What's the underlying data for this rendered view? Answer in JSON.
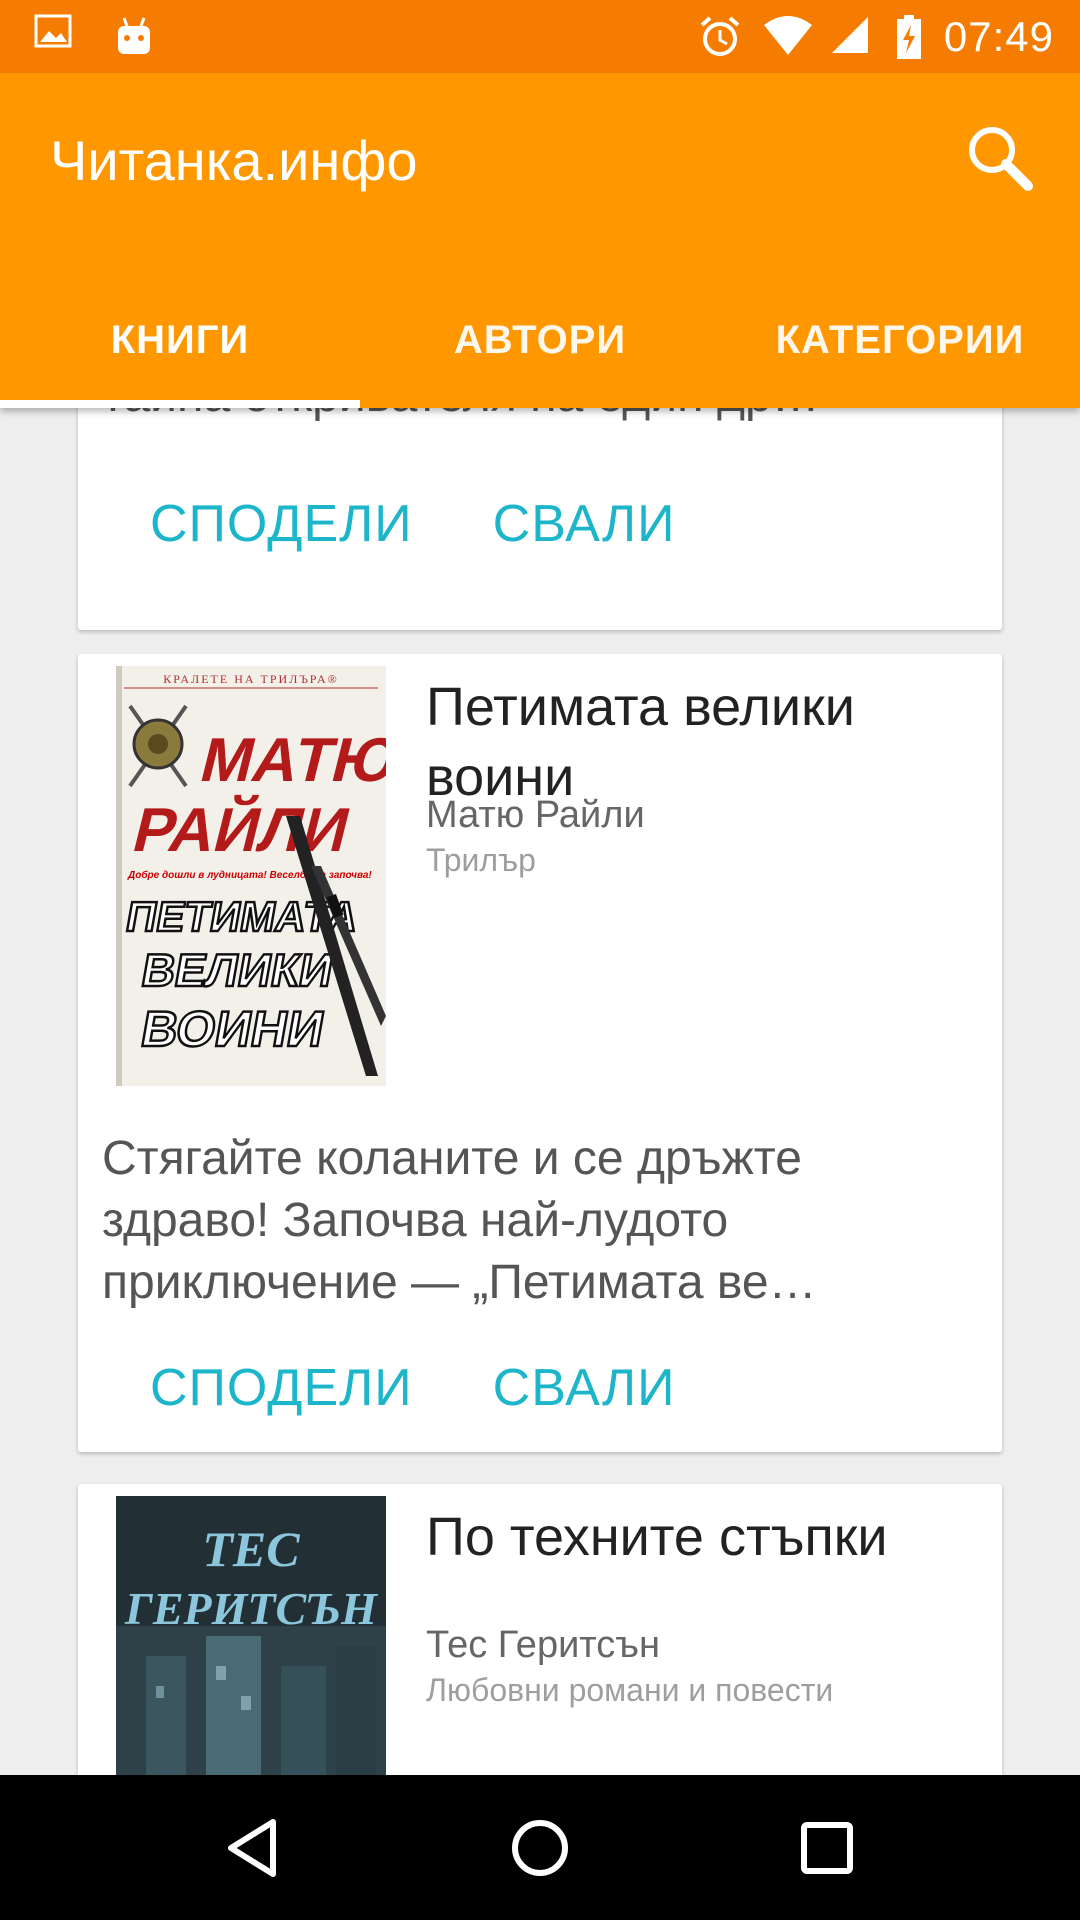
{
  "status_bar": {
    "time": "07:49",
    "left_icons": [
      "image-icon",
      "android-icon"
    ],
    "right_icons": [
      "alarm-icon",
      "wifi-icon",
      "signal-icon",
      "battery-charging-icon"
    ]
  },
  "app_bar": {
    "title": "Читанка.инфо",
    "search_icon": "search-icon"
  },
  "tabs": [
    {
      "label": "КНИГИ",
      "selected": true
    },
    {
      "label": "АВТОРИ",
      "selected": false
    },
    {
      "label": "КАТЕГОРИИ",
      "selected": false
    }
  ],
  "cards": [
    {
      "partial_text": "тайна откривателя на един др…",
      "share_label": "СПОДЕЛИ",
      "download_label": "СВАЛИ"
    },
    {
      "title": "Петимата велики воини",
      "author": "Матю Райли",
      "category": "Трилър",
      "description": " Стягайте коланите и се дръжте здраво! Започва най-лудото приключение — „Петимата ве…",
      "cover": {
        "series": "КРАЛЕТЕ НА ТРИЛЪРА®",
        "author_line1": "МАТЮ",
        "author_line2": "РАЙЛИ",
        "title_line1": "ПЕТИМАТА",
        "title_line2": "ВЕЛИКИ",
        "title_line3": "ВОИНИ",
        "tagline": "Добре дошли в лудницата! Веселбата започва!"
      },
      "share_label": "СПОДЕЛИ",
      "download_label": "СВАЛИ"
    },
    {
      "title": "По техните стъпки",
      "author": "Тес Геритсън",
      "category": "Любовни романи и повести",
      "cover": {
        "author_line1": "ТЕС",
        "author_line2": "ГЕРИТСЪН"
      }
    }
  ],
  "nav_bar": {
    "icons": [
      "back-icon",
      "home-icon",
      "recents-icon"
    ]
  },
  "colors": {
    "status_bar": "#f57c00",
    "app_bar": "#ff9800",
    "action_text": "#1cb5c9"
  }
}
